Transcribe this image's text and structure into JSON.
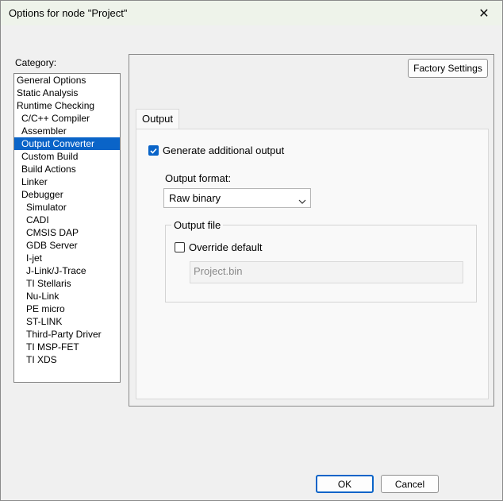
{
  "window": {
    "title": "Options for node \"Project\"",
    "close_symbol": "✕"
  },
  "category": {
    "label": "Category:",
    "items": [
      {
        "label": "General Options",
        "level": 0,
        "selected": false
      },
      {
        "label": "Static Analysis",
        "level": 0,
        "selected": false
      },
      {
        "label": "Runtime Checking",
        "level": 0,
        "selected": false
      },
      {
        "label": "C/C++ Compiler",
        "level": 1,
        "selected": false
      },
      {
        "label": "Assembler",
        "level": 1,
        "selected": false
      },
      {
        "label": "Output Converter",
        "level": 1,
        "selected": true
      },
      {
        "label": "Custom Build",
        "level": 1,
        "selected": false
      },
      {
        "label": "Build Actions",
        "level": 1,
        "selected": false
      },
      {
        "label": "Linker",
        "level": 1,
        "selected": false
      },
      {
        "label": "Debugger",
        "level": 1,
        "selected": false
      },
      {
        "label": "Simulator",
        "level": 2,
        "selected": false
      },
      {
        "label": "CADI",
        "level": 2,
        "selected": false
      },
      {
        "label": "CMSIS DAP",
        "level": 2,
        "selected": false
      },
      {
        "label": "GDB Server",
        "level": 2,
        "selected": false
      },
      {
        "label": "I-jet",
        "level": 2,
        "selected": false
      },
      {
        "label": "J-Link/J-Trace",
        "level": 2,
        "selected": false
      },
      {
        "label": "TI Stellaris",
        "level": 2,
        "selected": false
      },
      {
        "label": "Nu-Link",
        "level": 2,
        "selected": false
      },
      {
        "label": "PE micro",
        "level": 2,
        "selected": false
      },
      {
        "label": "ST-LINK",
        "level": 2,
        "selected": false
      },
      {
        "label": "Third-Party Driver",
        "level": 2,
        "selected": false
      },
      {
        "label": "TI MSP-FET",
        "level": 2,
        "selected": false
      },
      {
        "label": "TI XDS",
        "level": 2,
        "selected": false
      }
    ]
  },
  "panel": {
    "factory_settings_label": "Factory Settings",
    "tab_label": "Output",
    "generate_checkbox": {
      "label": "Generate additional output",
      "checked": true
    },
    "output_format_label": "Output format:",
    "output_format_value": "Raw binary",
    "output_file_group": "Output file",
    "override_checkbox": {
      "label": "Override default",
      "checked": false
    },
    "output_file_value": "Project.bin"
  },
  "buttons": {
    "ok_label": "OK",
    "cancel_label": "Cancel"
  },
  "colors": {
    "selection": "#0a64c8",
    "titlebar": "#eef3ea"
  }
}
